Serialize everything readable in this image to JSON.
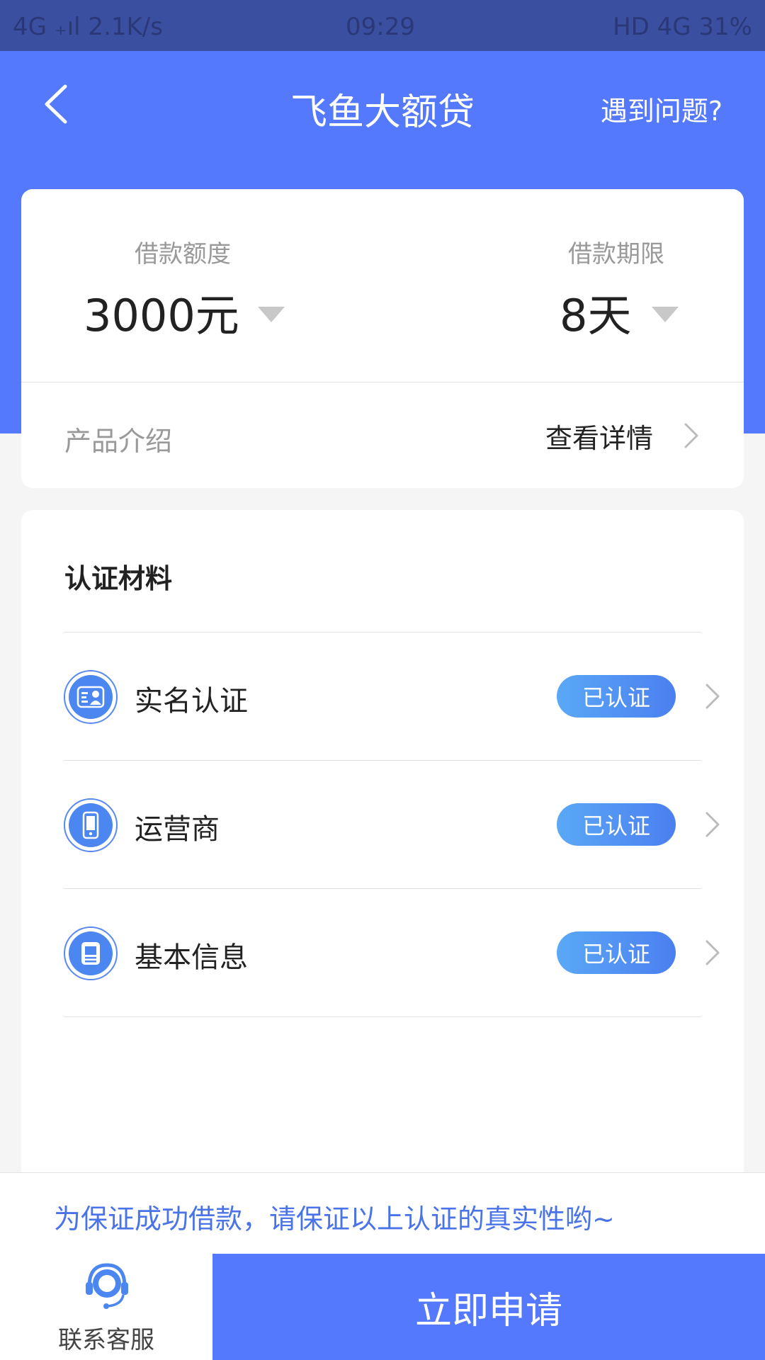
{
  "status_bar": {
    "left": "4G ₊ıl  2.1K/s",
    "time": "09:29",
    "right": "HD 4G 31%"
  },
  "nav": {
    "title": "飞鱼大额贷",
    "help": "遇到问题?"
  },
  "loan": {
    "amount_label": "借款额度",
    "amount_value": "3000元",
    "term_label": "借款期限",
    "term_value": "8天",
    "intro_label": "产品介绍",
    "detail_link": "查看详情"
  },
  "cert": {
    "title": "认证材料",
    "items": [
      {
        "label": "实名认证",
        "status": "已认证",
        "icon": "id-card-icon"
      },
      {
        "label": "运营商",
        "status": "已认证",
        "icon": "phone-icon"
      },
      {
        "label": "基本信息",
        "status": "已认证",
        "icon": "info-icon"
      }
    ]
  },
  "notice": "为保证成功借款，请保证以上认证的真实性哟~",
  "bottom": {
    "service_label": "联系客服",
    "apply_label": "立即申请"
  },
  "colors": {
    "primary": "#5479fc",
    "badge_start": "#5aa8f6",
    "badge_end": "#4b7ff0",
    "notice_text": "#4a73e8"
  }
}
